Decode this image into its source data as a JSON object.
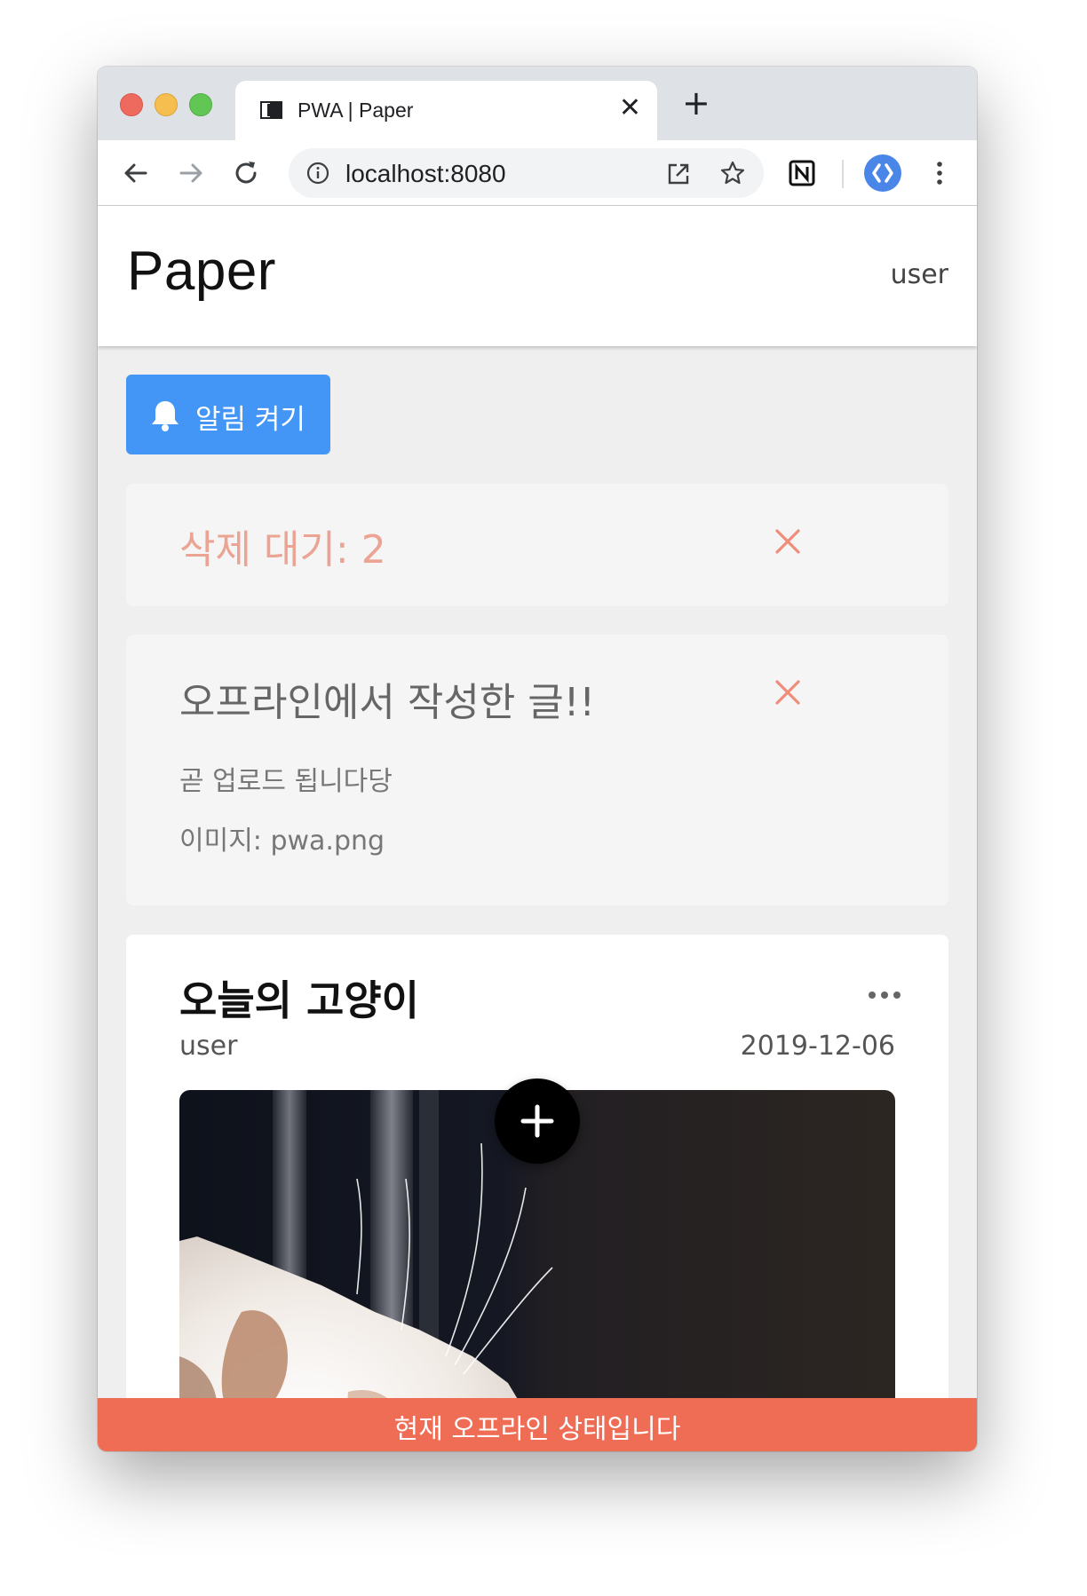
{
  "browser": {
    "tab_title": "PWA | Paper",
    "url": "localhost:8080",
    "new_tab_symbol": "+",
    "close_symbol": "✕"
  },
  "app": {
    "title": "Paper",
    "user": "user"
  },
  "notify_button": {
    "label": "알림 켜기",
    "icon": "bell-icon",
    "color": "#4396f5"
  },
  "pending_card": {
    "text": "삭제 대기: 2",
    "color": "#eba494"
  },
  "offline_post": {
    "title": "오프라인에서 작성한 글!!",
    "body": "곧 업로드 됩니다당",
    "image": "이미지: pwa.png"
  },
  "post": {
    "title": "오늘의 고양이",
    "author": "user",
    "date": "2019-12-06"
  },
  "offline_banner": {
    "text": "현재 오프라인 상태입니다",
    "color": "#ef6c55"
  }
}
